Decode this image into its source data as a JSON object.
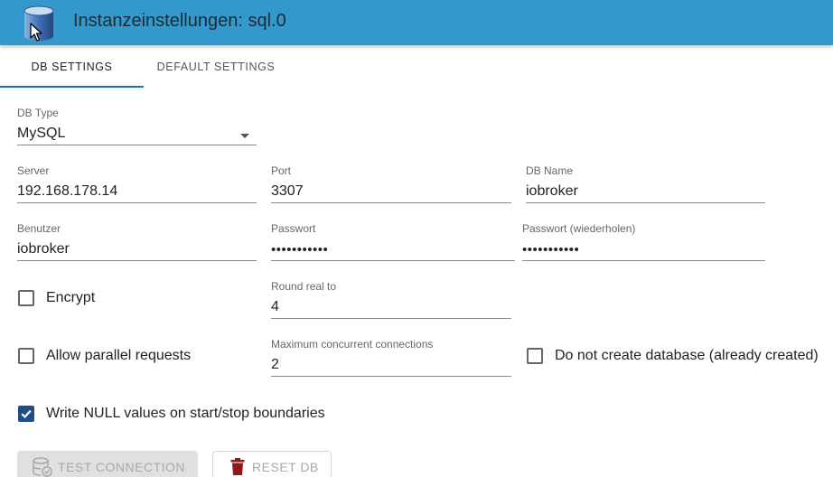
{
  "header": {
    "title": "Instanzeinstellungen: sql.0",
    "background": "#3399cc",
    "icon": "database-icon"
  },
  "tabs": [
    {
      "label": "DB SETTINGS",
      "active": true
    },
    {
      "label": "DEFAULT SETTINGS",
      "active": false
    }
  ],
  "form": {
    "db_type": {
      "label": "DB Type",
      "value": "MySQL"
    },
    "server": {
      "label": "Server",
      "value": "192.168.178.14"
    },
    "port": {
      "label": "Port",
      "value": "3307"
    },
    "db_name": {
      "label": "DB Name",
      "value": "iobroker"
    },
    "user": {
      "label": "Benutzer",
      "value": "iobroker"
    },
    "password": {
      "label": "Passwort",
      "value": "•••••••••••"
    },
    "password_repeat": {
      "label": "Passwort (wiederholen)",
      "value": "•••••••••••"
    },
    "round_real": {
      "label": "Round real to",
      "value": "4"
    },
    "max_connections": {
      "label": "Maximum concurrent connections",
      "value": "2"
    }
  },
  "checkboxes": {
    "encrypt": {
      "label": "Encrypt",
      "checked": false
    },
    "parallel": {
      "label": "Allow parallel requests",
      "checked": false
    },
    "no_create_db": {
      "label": "Do not create database (already created)",
      "checked": false
    },
    "write_null": {
      "label": "Write NULL values on start/stop boundaries",
      "checked": true
    }
  },
  "buttons": {
    "test_connection": {
      "label": "TEST CONNECTION",
      "icon": "database-check-icon",
      "disabled": true
    },
    "reset_db": {
      "label": "RESET DB",
      "icon": "trash-icon",
      "icon_color": "#8b1a1a",
      "disabled": true
    }
  },
  "colors": {
    "accent": "#1f4e86",
    "tab_indicator": "#1a73b8"
  }
}
